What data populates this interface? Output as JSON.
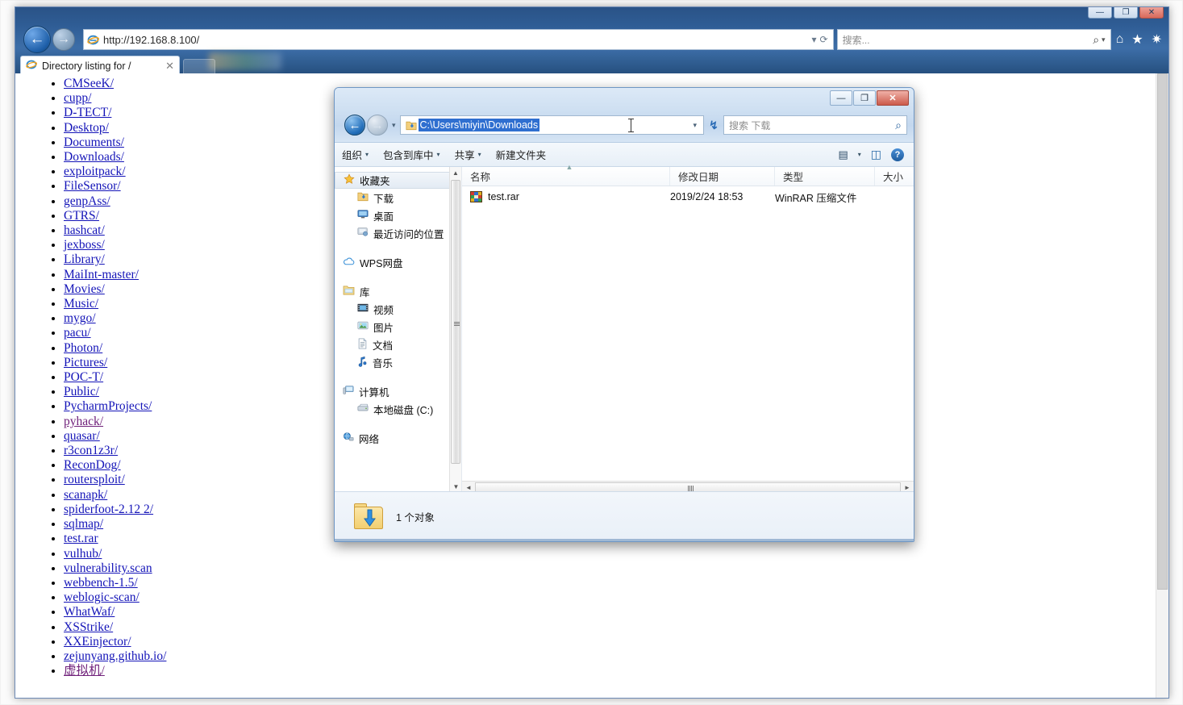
{
  "browser": {
    "window_title": "Directory listing for /",
    "address": "http://192.168.8.100/",
    "search_placeholder": "搜索...",
    "tab_title": "Directory listing for /",
    "tab_close": "✕",
    "back_icon": "←",
    "forward_icon": "→",
    "refresh_icon": "⟳",
    "addr_dropdown_icon": "▾",
    "home_icon": "⌂",
    "favorites_icon": "★",
    "tools_icon": "✷",
    "search_icon": "⌕",
    "search_dropdown_icon": "▾",
    "minimize_label": "—",
    "maximize_label": "❐",
    "close_label": "✕"
  },
  "directory_listing": {
    "entries": [
      {
        "name": "CMSeeK/",
        "visited": false
      },
      {
        "name": "cupp/",
        "visited": false
      },
      {
        "name": "D-TECT/",
        "visited": false
      },
      {
        "name": "Desktop/",
        "visited": false
      },
      {
        "name": "Documents/",
        "visited": false
      },
      {
        "name": "Downloads/",
        "visited": false
      },
      {
        "name": "exploitpack/",
        "visited": false
      },
      {
        "name": "FileSensor/",
        "visited": false
      },
      {
        "name": "genpAss/",
        "visited": false
      },
      {
        "name": "GTRS/",
        "visited": false
      },
      {
        "name": "hashcat/",
        "visited": false
      },
      {
        "name": "jexboss/",
        "visited": false
      },
      {
        "name": "Library/",
        "visited": false
      },
      {
        "name": "MaiInt-master/",
        "visited": false
      },
      {
        "name": "Movies/",
        "visited": false
      },
      {
        "name": "Music/",
        "visited": false
      },
      {
        "name": "mygo/",
        "visited": false
      },
      {
        "name": "pacu/",
        "visited": false
      },
      {
        "name": "Photon/",
        "visited": false
      },
      {
        "name": "Pictures/",
        "visited": false
      },
      {
        "name": "POC-T/",
        "visited": false
      },
      {
        "name": "Public/",
        "visited": false
      },
      {
        "name": "PycharmProjects/",
        "visited": false
      },
      {
        "name": "pyhack/",
        "visited": true
      },
      {
        "name": "quasar/",
        "visited": false
      },
      {
        "name": "r3con1z3r/",
        "visited": false
      },
      {
        "name": "ReconDog/",
        "visited": false
      },
      {
        "name": "routersploit/",
        "visited": false
      },
      {
        "name": "scanapk/",
        "visited": false
      },
      {
        "name": "spiderfoot-2.12 2/",
        "visited": false
      },
      {
        "name": "sqlmap/",
        "visited": false
      },
      {
        "name": "test.rar",
        "visited": false
      },
      {
        "name": "vulhub/",
        "visited": false
      },
      {
        "name": "vulnerability.scan",
        "visited": false
      },
      {
        "name": "webbench-1.5/",
        "visited": false
      },
      {
        "name": "weblogic-scan/",
        "visited": false
      },
      {
        "name": "WhatWaf/",
        "visited": false
      },
      {
        "name": "XSStrike/",
        "visited": false
      },
      {
        "name": "XXEinjector/",
        "visited": false
      },
      {
        "name": "zejunyang.github.io/",
        "visited": false
      },
      {
        "name": "虚拟机/",
        "visited": true
      }
    ]
  },
  "explorer": {
    "address_value": "C:\\Users\\miyin\\Downloads",
    "search_placeholder": "搜索 下载",
    "back_icon": "←",
    "forward_icon": "→",
    "nav_dropdown_icon": "▾",
    "address_dropdown_icon": "▾",
    "refresh_icon": "↯",
    "search_icon": "⌕",
    "minimize_label": "—",
    "maximize_label": "❐",
    "close_label": "✕",
    "toolbar": {
      "organize": "组织",
      "include_in_library": "包含到库中",
      "share": "共享",
      "new_folder": "新建文件夹",
      "view_icon": "▤",
      "view_caret": "▾",
      "preview_pane_icon": "◫",
      "help_icon": "?"
    },
    "sidebar": {
      "favorites": "收藏夹",
      "downloads": "下载",
      "desktop": "桌面",
      "recent_places": "最近访问的位置",
      "wps_cloud": "WPS网盘",
      "libraries": "库",
      "videos": "视频",
      "pictures": "图片",
      "documents": "文档",
      "music": "音乐",
      "computer": "计算机",
      "local_disk": "本地磁盘 (C:)",
      "network": "网络",
      "scroll_up_icon": "▲",
      "scroll_down_icon": "▼"
    },
    "columns": {
      "name": "名称",
      "date_modified": "修改日期",
      "type": "类型",
      "size": "大小",
      "sort_indicator": "▲"
    },
    "files": [
      {
        "name": "test.rar",
        "date_modified": "2019/2/24 18:53",
        "type": "WinRAR 压缩文件",
        "size": "",
        "icon": "winrar-icon"
      }
    ],
    "status": "1 个对象",
    "hscroll_left_icon": "◄",
    "hscroll_right_icon": "►"
  },
  "colors": {
    "ie_chrome": "#2f5d95",
    "link": "#1414b8",
    "link_visited": "#70217a",
    "selection": "#2f6fd0",
    "close_button": "#cc5a4b"
  }
}
